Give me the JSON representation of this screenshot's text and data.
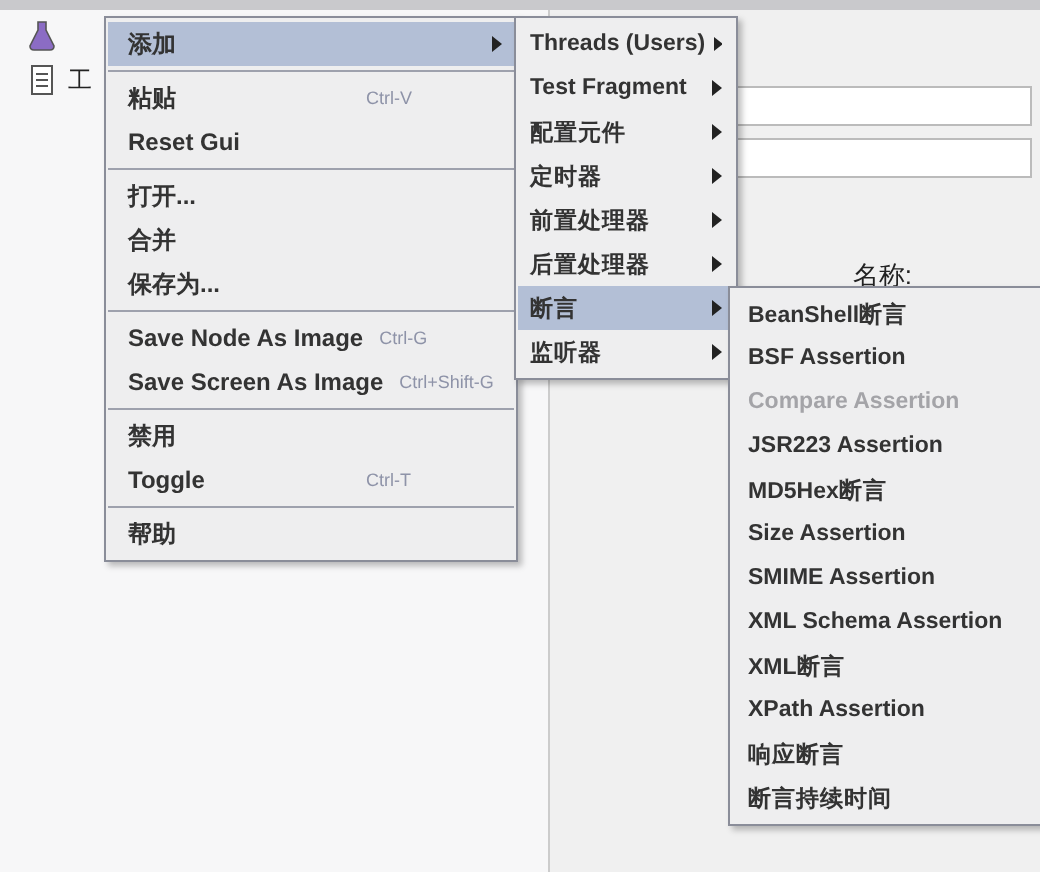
{
  "tree": {
    "items": [
      {
        "label": "工"
      }
    ]
  },
  "panel": {
    "name_label": "名称:"
  },
  "context_menu": {
    "groups": [
      [
        {
          "label": "添加",
          "selected": true,
          "submenu": true
        }
      ],
      [
        {
          "label": "粘贴",
          "shortcut": "Ctrl-V",
          "selected": false
        },
        {
          "label": "Reset Gui",
          "selected": false
        }
      ],
      [
        {
          "label": "打开...",
          "selected": false
        },
        {
          "label": "合并",
          "selected": false
        },
        {
          "label": "保存为...",
          "selected": false
        }
      ],
      [
        {
          "label": "Save Node As Image",
          "shortcut": "Ctrl-G",
          "selected": false
        },
        {
          "label": "Save Screen As Image",
          "shortcut": "Ctrl+Shift-G",
          "selected": false
        }
      ],
      [
        {
          "label": "禁用",
          "selected": false
        },
        {
          "label": "Toggle",
          "shortcut": "Ctrl-T",
          "selected": false
        }
      ],
      [
        {
          "label": "帮助",
          "selected": false
        }
      ]
    ]
  },
  "add_submenu": {
    "items": [
      {
        "label": "Threads (Users)",
        "selected": false
      },
      {
        "label": "Test Fragment",
        "selected": false
      },
      {
        "label": "配置元件",
        "selected": false
      },
      {
        "label": "定时器",
        "selected": false
      },
      {
        "label": "前置处理器",
        "selected": false
      },
      {
        "label": "后置处理器",
        "selected": false
      },
      {
        "label": "断言",
        "selected": true
      },
      {
        "label": "监听器",
        "selected": false
      }
    ]
  },
  "assertion_submenu": {
    "items": [
      {
        "label": "BeanShell断言",
        "disabled": false
      },
      {
        "label": "BSF Assertion",
        "disabled": false
      },
      {
        "label": "Compare Assertion",
        "disabled": true
      },
      {
        "label": "JSR223 Assertion",
        "disabled": false
      },
      {
        "label": "MD5Hex断言",
        "disabled": false
      },
      {
        "label": "Size Assertion",
        "disabled": false
      },
      {
        "label": "SMIME Assertion",
        "disabled": false
      },
      {
        "label": "XML Schema Assertion",
        "disabled": false
      },
      {
        "label": "XML断言",
        "disabled": false
      },
      {
        "label": "XPath Assertion",
        "disabled": false
      },
      {
        "label": "响应断言",
        "disabled": false
      },
      {
        "label": "断言持续时间",
        "disabled": false
      }
    ]
  }
}
